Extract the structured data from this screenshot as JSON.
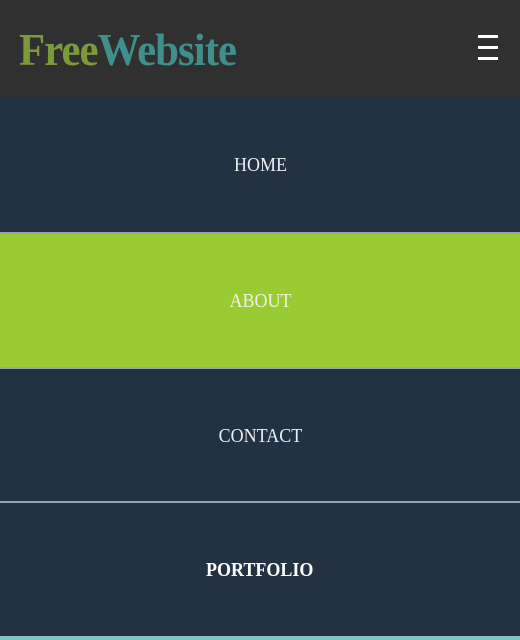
{
  "header": {
    "logo_part1": "Free",
    "logo_part2": "Website",
    "menu_icon": "hamburger-menu-icon"
  },
  "nav": {
    "items": [
      {
        "label": "HOME",
        "active": false
      },
      {
        "label": "ABOUT",
        "active": true
      },
      {
        "label": "CONTACT",
        "active": false
      },
      {
        "label": "PORTFOLIO",
        "active": false
      }
    ]
  },
  "colors": {
    "header_bg": "#303030",
    "nav_bg": "#223242",
    "active_bg": "#99cc33",
    "logo_free": "#7c9a3a",
    "logo_website": "#3f8f8c"
  }
}
